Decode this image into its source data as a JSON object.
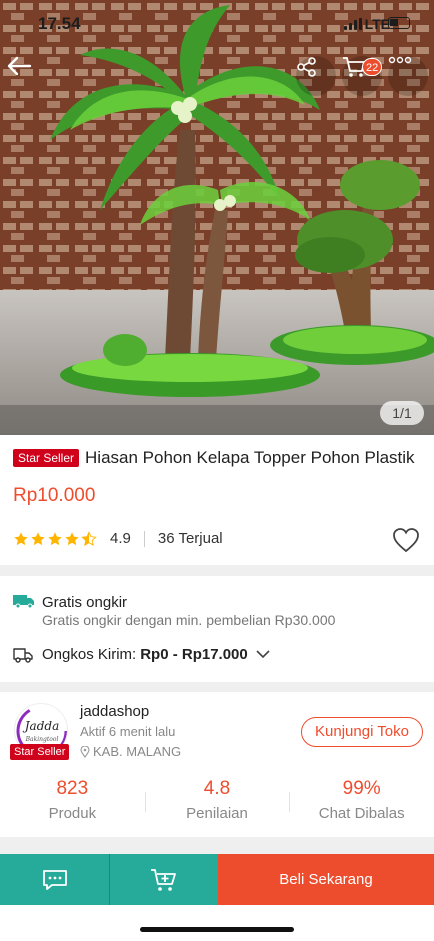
{
  "status_bar": {
    "time": "17.54",
    "network": "LTE"
  },
  "hero": {
    "image_counter": "1/1",
    "cart_count": "22"
  },
  "product": {
    "badge": "Star Seller",
    "title": "Hiasan Pohon Kelapa Topper Pohon Plastik",
    "price": "Rp10.000",
    "rating": "4.9",
    "rating_stars": 4.5,
    "sold": "36 Terjual"
  },
  "shipping": {
    "free_title": "Gratis ongkir",
    "free_subtitle": "Gratis ongkir dengan min. pembelian Rp30.000",
    "cost_label": "Ongkos Kirim:",
    "cost_value": "Rp0 - Rp17.000"
  },
  "shop": {
    "name": "jaddashop",
    "active": "Aktif 6 menit lalu",
    "location": "KAB. MALANG",
    "badge": "Star Seller",
    "logo_text": "Jadda",
    "logo_subtext": "Bakingtool",
    "visit_label": "Kunjungi Toko",
    "stats": [
      {
        "value": "823",
        "label": "Produk"
      },
      {
        "value": "4.8",
        "label": "Penilaian"
      },
      {
        "value": "99%",
        "label": "Chat Dibalas"
      }
    ]
  },
  "bottom_bar": {
    "buy_label": "Beli Sekarang"
  },
  "colors": {
    "brand": "#ee4d2d",
    "teal": "#26aa99",
    "star": "#ffb400",
    "badge": "#d0011b"
  },
  "icons": [
    "back-arrow-icon",
    "share-icon",
    "cart-icon",
    "more-icon",
    "star-icon",
    "heart-icon",
    "free-shipping-truck-icon",
    "truck-icon",
    "chevron-down-icon",
    "location-pin-icon",
    "chat-icon",
    "add-to-cart-icon"
  ]
}
